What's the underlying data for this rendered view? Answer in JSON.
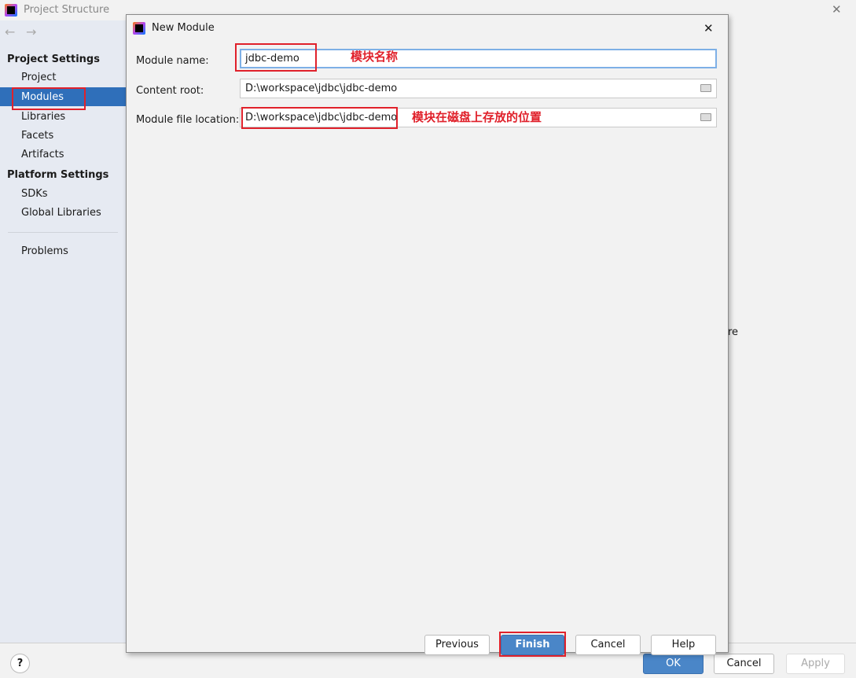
{
  "window": {
    "title": "Project Structure",
    "back": "←",
    "forward": "→",
    "close": "✕",
    "help": "?"
  },
  "sidebar": {
    "project_settings": "Project Settings",
    "items": [
      "Project",
      "Modules",
      "Libraries",
      "Facets",
      "Artifacts"
    ],
    "platform_settings": "Platform Settings",
    "platform_items": [
      "SDKs",
      "Global Libraries"
    ],
    "problems": "Problems"
  },
  "background_text": "re",
  "footer": {
    "ok": "OK",
    "cancel": "Cancel",
    "apply": "Apply"
  },
  "dialog": {
    "title": "New Module",
    "close": "✕",
    "module_name_label": "Module name:",
    "module_name": "jdbc-demo",
    "content_root_label": "Content root:",
    "content_root": "D:\\workspace\\jdbc\\jdbc-demo",
    "file_location_label": "Module file location:",
    "file_location": "D:\\workspace\\jdbc\\jdbc-demo",
    "buttons": {
      "previous": "Previous",
      "finish": "Finish",
      "cancel": "Cancel",
      "help": "Help"
    }
  },
  "annotations": {
    "name": "模块名称",
    "location": "模块在磁盘上存放的位置"
  },
  "colors": {
    "accent": "#2f6fba",
    "annotation": "#e0212b"
  }
}
